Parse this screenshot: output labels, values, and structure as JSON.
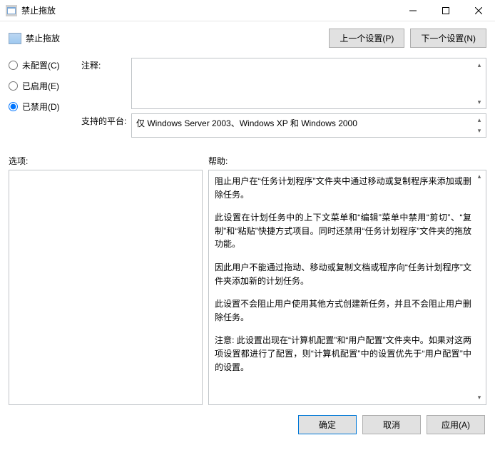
{
  "window": {
    "title": "禁止拖放",
    "minimize_tip": "minimize",
    "maximize_tip": "maximize",
    "close_tip": "close"
  },
  "header": {
    "title": "禁止拖放",
    "prev_setting_label": "上一个设置(P)",
    "next_setting_label": "下一个设置(N)"
  },
  "radios": {
    "not_configured": "未配置(C)",
    "enabled": "已启用(E)",
    "disabled": "已禁用(D)",
    "selected": "disabled"
  },
  "fields": {
    "comment_label": "注释:",
    "comment_value": "",
    "platform_label": "支持的平台:",
    "platform_value": "仅 Windows Server 2003、Windows XP 和 Windows 2000"
  },
  "section": {
    "options_label": "选项:",
    "help_label": "帮助:"
  },
  "help": {
    "p1": "阻止用户在“任务计划程序”文件夹中通过移动或复制程序来添加或删除任务。",
    "p2": "此设置在计划任务中的上下文菜单和“编辑”菜单中禁用“剪切”、“复制”和“粘贴”快捷方式项目。同时还禁用“任务计划程序”文件夹的拖放功能。",
    "p3": "因此用户不能通过拖动、移动或复制文档或程序向“任务计划程序”文件夹添加新的计划任务。",
    "p4": "此设置不会阻止用户使用其他方式创建新任务，并且不会阻止用户删除任务。",
    "p5": "注意: 此设置出现在“计算机配置”和“用户配置”文件夹中。如果对这两项设置都进行了配置，则“计算机配置”中的设置优先于“用户配置”中的设置。"
  },
  "footer": {
    "ok": "确定",
    "cancel": "取消",
    "apply": "应用(A)"
  }
}
